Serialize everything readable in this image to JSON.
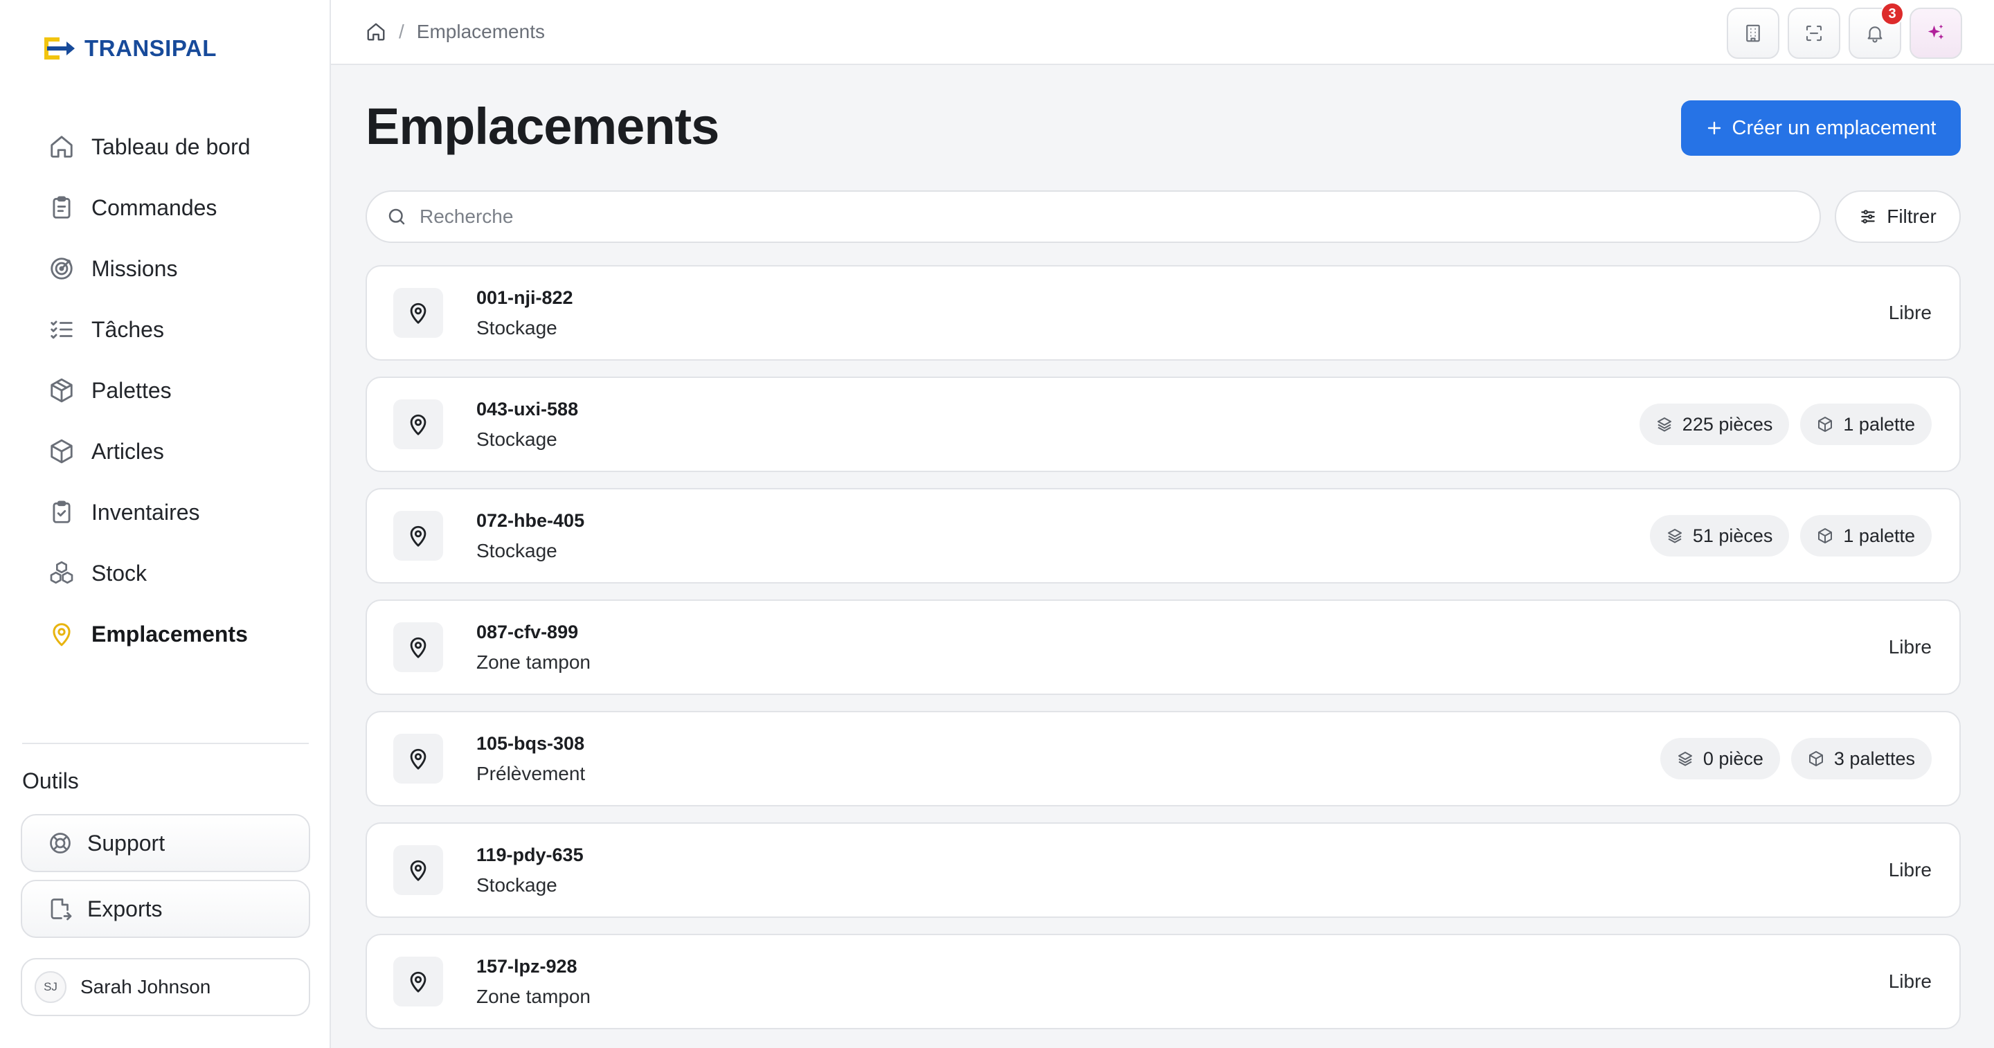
{
  "brand": {
    "name": "TRANSIPAL",
    "colors": {
      "blue": "#174a9a",
      "yellow": "#f2c40f"
    }
  },
  "sidebar": {
    "items": [
      {
        "label": "Tableau de bord",
        "icon": "home-icon",
        "active": false
      },
      {
        "label": "Commandes",
        "icon": "clipboard-icon",
        "active": false
      },
      {
        "label": "Missions",
        "icon": "target-icon",
        "active": false
      },
      {
        "label": "Tâches",
        "icon": "checklist-icon",
        "active": false
      },
      {
        "label": "Palettes",
        "icon": "package-icon",
        "active": false
      },
      {
        "label": "Articles",
        "icon": "box-icon",
        "active": false
      },
      {
        "label": "Inventaires",
        "icon": "clipboard-check-icon",
        "active": false
      },
      {
        "label": "Stock",
        "icon": "boxes-icon",
        "active": false
      },
      {
        "label": "Emplacements",
        "icon": "map-pin-icon",
        "active": true
      }
    ],
    "tools_title": "Outils",
    "tools": [
      {
        "label": "Support",
        "icon": "lifebuoy-icon"
      },
      {
        "label": "Exports",
        "icon": "file-export-icon"
      }
    ],
    "user": {
      "initials": "SJ",
      "name": "Sarah Johnson"
    }
  },
  "topbar": {
    "breadcrumb": {
      "home_icon": "home-icon",
      "separator": "/",
      "current": "Emplacements"
    },
    "icons": [
      "building-icon",
      "scan-icon",
      "bell-icon",
      "sparkles-icon"
    ],
    "notification_count": "3"
  },
  "main": {
    "title": "Emplacements",
    "create_button": "Créer un emplacement",
    "search_placeholder": "Recherche",
    "filter_label": "Filtrer",
    "accent_color": "#2673e6",
    "locations": [
      {
        "code": "001-nji-822",
        "type": "Stockage",
        "status": "Libre"
      },
      {
        "code": "043-uxi-588",
        "type": "Stockage",
        "pieces": "225 pièces",
        "pallets": "1 palette"
      },
      {
        "code": "072-hbe-405",
        "type": "Stockage",
        "pieces": "51 pièces",
        "pallets": "1 palette"
      },
      {
        "code": "087-cfv-899",
        "type": "Zone tampon",
        "status": "Libre"
      },
      {
        "code": "105-bqs-308",
        "type": "Prélèvement",
        "pieces": "0 pièce",
        "pallets": "3 palettes"
      },
      {
        "code": "119-pdy-635",
        "type": "Stockage",
        "status": "Libre"
      },
      {
        "code": "157-lpz-928",
        "type": "Zone tampon",
        "status": "Libre"
      }
    ]
  }
}
